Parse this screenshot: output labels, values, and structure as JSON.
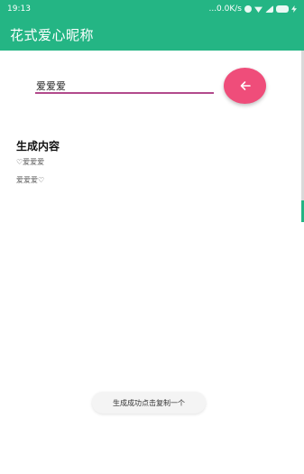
{
  "status_bar": {
    "time": "19:13",
    "network_speed": "...0.0K/s",
    "icons": [
      "alarm-icon",
      "wifi-icon",
      "signal-icon",
      "battery-icon",
      "charging-icon"
    ]
  },
  "app_bar": {
    "title": "花式爱心昵称",
    "background_color": "#24b584"
  },
  "input": {
    "value": "爱爱爱",
    "underline_color": "#b24a8c"
  },
  "generate_button": {
    "icon": "arrow-left-icon",
    "color": "#ef4d7a"
  },
  "results": {
    "heading": "生成内容",
    "items": [
      "♡爱爱爱",
      "爱爱爱♡"
    ]
  },
  "toast": {
    "message": "生成成功点击复制一个"
  }
}
